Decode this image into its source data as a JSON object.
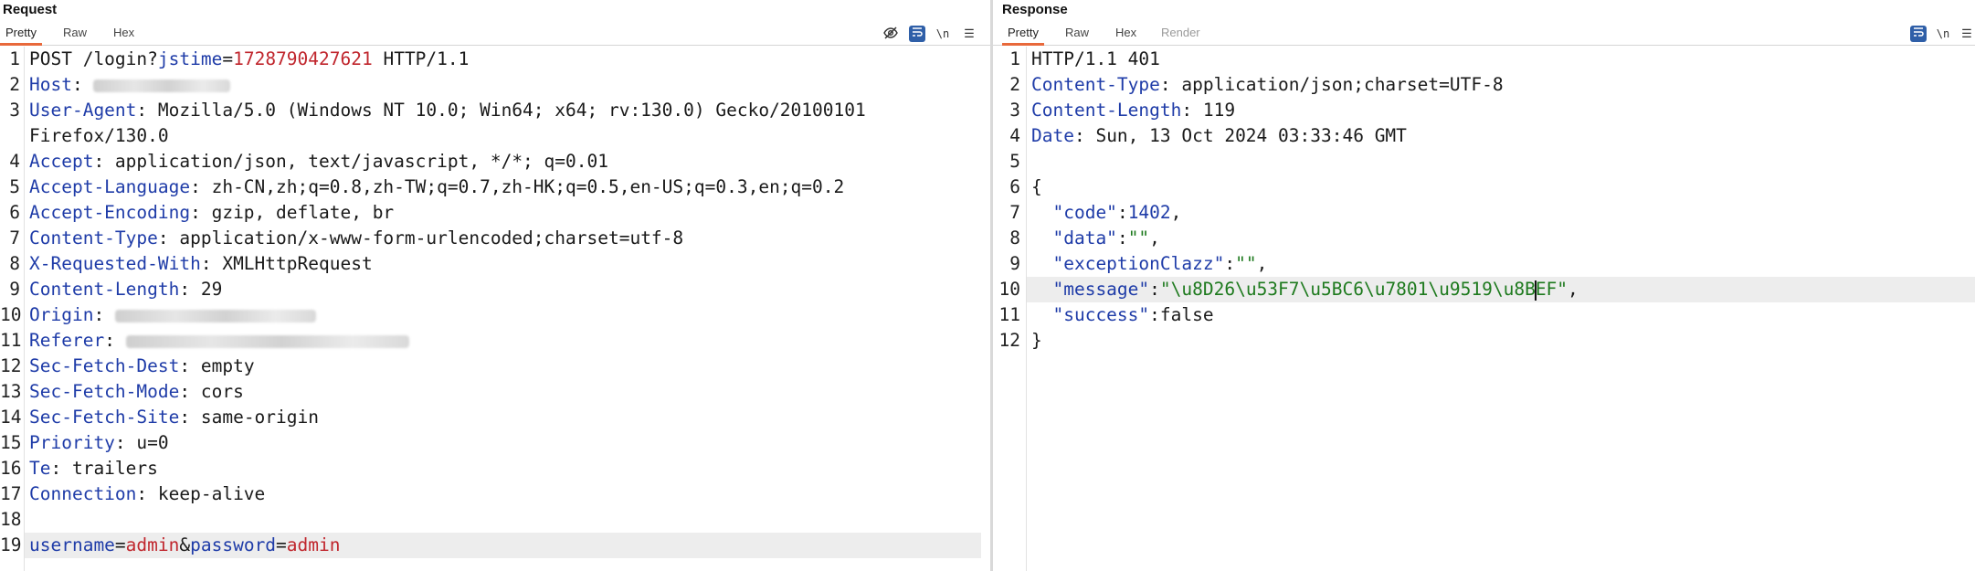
{
  "request": {
    "title": "Request",
    "tabs": [
      "Pretty",
      "Raw",
      "Hex"
    ],
    "lines": [
      {
        "n": "1",
        "parts": [
          [
            "p",
            "POST /login?"
          ],
          [
            "k",
            "jstime"
          ],
          [
            "p",
            "="
          ],
          [
            "r",
            "1728790427621"
          ],
          [
            "p",
            " HTTP/1.1"
          ]
        ]
      },
      {
        "n": "2",
        "parts": [
          [
            "k",
            "Host"
          ],
          [
            "p",
            ": "
          ],
          [
            "blur",
            "150"
          ]
        ]
      },
      {
        "n": "3",
        "parts": [
          [
            "k",
            "User-Agent"
          ],
          [
            "p",
            ": Mozilla/5.0 (Windows NT 10.0; Win64; x64; rv:130.0) Gecko/20100101"
          ]
        ]
      },
      {
        "n": "",
        "parts": [
          [
            "p",
            "Firefox/130.0"
          ]
        ]
      },
      {
        "n": "4",
        "parts": [
          [
            "k",
            "Accept"
          ],
          [
            "p",
            ": application/json, text/javascript, */*; q=0.01"
          ]
        ]
      },
      {
        "n": "5",
        "parts": [
          [
            "k",
            "Accept-Language"
          ],
          [
            "p",
            ": zh-CN,zh;q=0.8,zh-TW;q=0.7,zh-HK;q=0.5,en-US;q=0.3,en;q=0.2"
          ]
        ]
      },
      {
        "n": "6",
        "parts": [
          [
            "k",
            "Accept-Encoding"
          ],
          [
            "p",
            ": gzip, deflate, br"
          ]
        ]
      },
      {
        "n": "7",
        "parts": [
          [
            "k",
            "Content-Type"
          ],
          [
            "p",
            ": application/x-www-form-urlencoded;charset=utf-8"
          ]
        ]
      },
      {
        "n": "8",
        "parts": [
          [
            "k",
            "X-Requested-With"
          ],
          [
            "p",
            ": XMLHttpRequest"
          ]
        ]
      },
      {
        "n": "9",
        "parts": [
          [
            "k",
            "Content-Length"
          ],
          [
            "p",
            ": 29"
          ]
        ]
      },
      {
        "n": "10",
        "parts": [
          [
            "k",
            "Origin"
          ],
          [
            "p",
            ": "
          ],
          [
            "blur",
            "220"
          ]
        ]
      },
      {
        "n": "11",
        "parts": [
          [
            "k",
            "Referer"
          ],
          [
            "p",
            ": "
          ],
          [
            "blur",
            "310"
          ]
        ]
      },
      {
        "n": "12",
        "parts": [
          [
            "k",
            "Sec-Fetch-Dest"
          ],
          [
            "p",
            ": empty"
          ]
        ]
      },
      {
        "n": "13",
        "parts": [
          [
            "k",
            "Sec-Fetch-Mode"
          ],
          [
            "p",
            ": cors"
          ]
        ]
      },
      {
        "n": "14",
        "parts": [
          [
            "k",
            "Sec-Fetch-Site"
          ],
          [
            "p",
            ": same-origin"
          ]
        ]
      },
      {
        "n": "15",
        "parts": [
          [
            "k",
            "Priority"
          ],
          [
            "p",
            ": u=0"
          ]
        ]
      },
      {
        "n": "16",
        "parts": [
          [
            "k",
            "Te"
          ],
          [
            "p",
            ": trailers"
          ]
        ]
      },
      {
        "n": "17",
        "parts": [
          [
            "k",
            "Connection"
          ],
          [
            "p",
            ": keep-alive"
          ]
        ]
      },
      {
        "n": "18",
        "parts": []
      },
      {
        "n": "19",
        "hl": true,
        "parts": [
          [
            "k",
            "username"
          ],
          [
            "p",
            "="
          ],
          [
            "r",
            "admin"
          ],
          [
            "p",
            "&"
          ],
          [
            "k",
            "password"
          ],
          [
            "p",
            "="
          ],
          [
            "r",
            "admin"
          ]
        ]
      }
    ]
  },
  "response": {
    "title": "Response",
    "tabs": [
      "Pretty",
      "Raw",
      "Hex",
      "Render"
    ],
    "lines": [
      {
        "n": "1",
        "parts": [
          [
            "p",
            "HTTP/1.1 401"
          ]
        ]
      },
      {
        "n": "2",
        "parts": [
          [
            "k",
            "Content-Type"
          ],
          [
            "p",
            ": application/json;charset=UTF-8"
          ]
        ]
      },
      {
        "n": "3",
        "parts": [
          [
            "k",
            "Content-Length"
          ],
          [
            "p",
            ": 119"
          ]
        ]
      },
      {
        "n": "4",
        "parts": [
          [
            "k",
            "Date"
          ],
          [
            "p",
            ": Sun, 13 Oct 2024 03:33:46 GMT"
          ]
        ]
      },
      {
        "n": "5",
        "parts": []
      },
      {
        "n": "6",
        "parts": [
          [
            "p",
            "{"
          ]
        ]
      },
      {
        "n": "7",
        "parts": [
          [
            "p",
            "  "
          ],
          [
            "k",
            "\"code\""
          ],
          [
            "p",
            ":"
          ],
          [
            "b",
            "1402"
          ],
          [
            "p",
            ","
          ]
        ]
      },
      {
        "n": "8",
        "parts": [
          [
            "p",
            "  "
          ],
          [
            "k",
            "\"data\""
          ],
          [
            "p",
            ":"
          ],
          [
            "g",
            "\"\""
          ],
          [
            "p",
            ","
          ]
        ]
      },
      {
        "n": "9",
        "parts": [
          [
            "p",
            "  "
          ],
          [
            "k",
            "\"exceptionClazz\""
          ],
          [
            "p",
            ":"
          ],
          [
            "g",
            "\"\""
          ],
          [
            "p",
            ","
          ]
        ]
      },
      {
        "n": "10",
        "hl": true,
        "parts": [
          [
            "p",
            "  "
          ],
          [
            "k",
            "\"message\""
          ],
          [
            "p",
            ":"
          ],
          [
            "g",
            "\"\\u8D26\\u53F7\\u5BC6\\u7801\\u9519\\u8B"
          ],
          [
            "caret",
            ""
          ],
          [
            "g",
            "EF\""
          ],
          [
            "p",
            ","
          ]
        ]
      },
      {
        "n": "11",
        "parts": [
          [
            "p",
            "  "
          ],
          [
            "k",
            "\"success\""
          ],
          [
            "p",
            ":false"
          ]
        ]
      },
      {
        "n": "12",
        "parts": [
          [
            "p",
            "}"
          ]
        ]
      }
    ]
  },
  "icons": {
    "hide": "eye-off-icon",
    "wrap": "word-wrap-icon",
    "newline": "newline-icon",
    "menu": "hamburger-menu-icon"
  },
  "colors": {
    "accent": "#e8693b",
    "key": "#1f3ca8",
    "value_red": "#c0262d",
    "string_green": "#1e7a1e"
  }
}
